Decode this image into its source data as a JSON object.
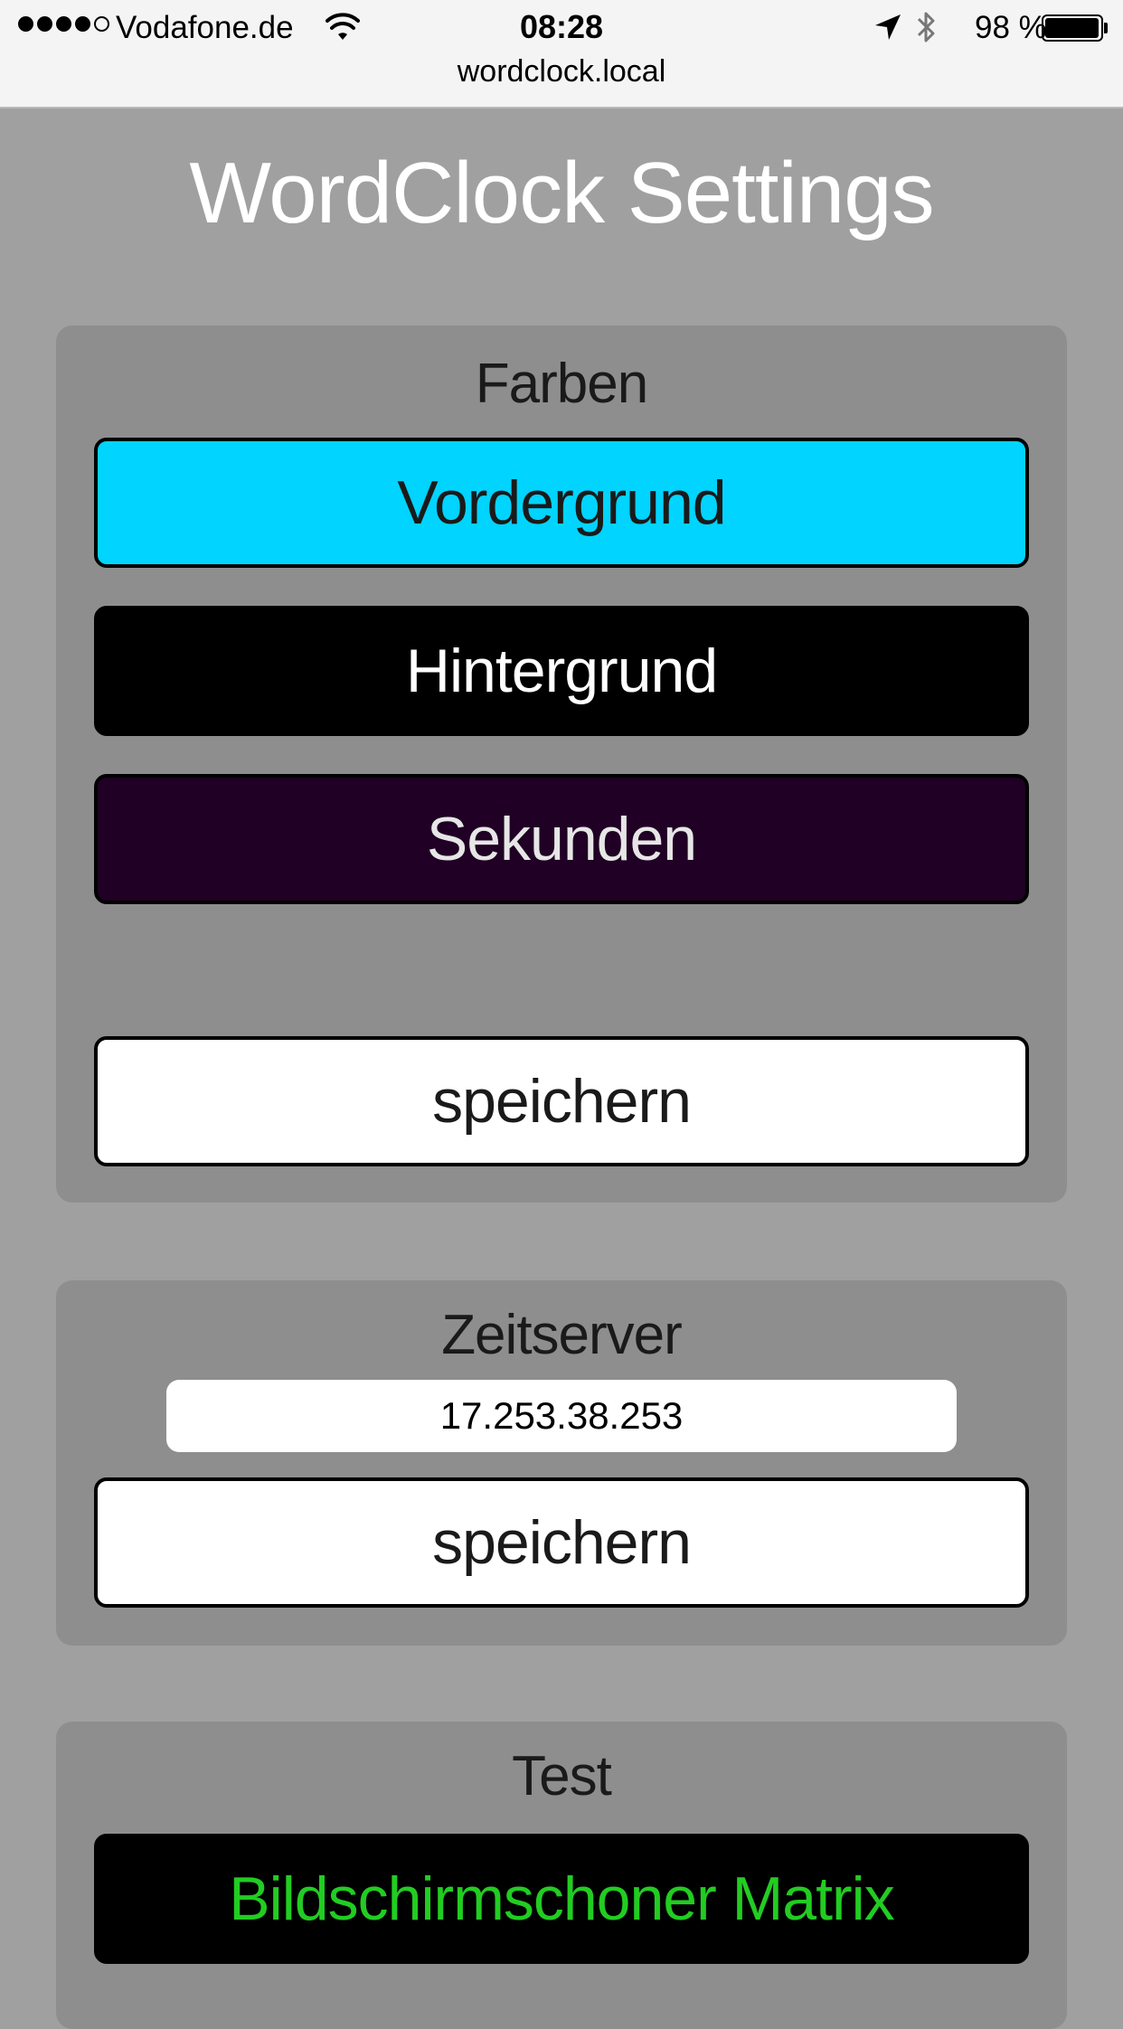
{
  "status_bar": {
    "carrier": "Vodafone.de",
    "time": "08:28",
    "battery_percent": "98 %",
    "battery_level": 0.98,
    "signal_bars_filled": 4,
    "signal_bars_total": 5
  },
  "browser": {
    "url": "wordclock.local"
  },
  "page": {
    "title": "WordClock Settings"
  },
  "colors_section": {
    "title": "Farben",
    "foreground_label": "Vordergrund",
    "background_label": "Hintergrund",
    "seconds_label": "Sekunden",
    "save_label": "speichern",
    "foreground_color": "#00d4ff",
    "background_color": "#000000",
    "seconds_color": "#200024"
  },
  "timeserver_section": {
    "title": "Zeitserver",
    "server_value": "17.253.38.253",
    "save_label": "speichern"
  },
  "test_section": {
    "title": "Test",
    "matrix_label": "Bildschirmschoner Matrix",
    "matrix_text_color": "#22cc22"
  }
}
